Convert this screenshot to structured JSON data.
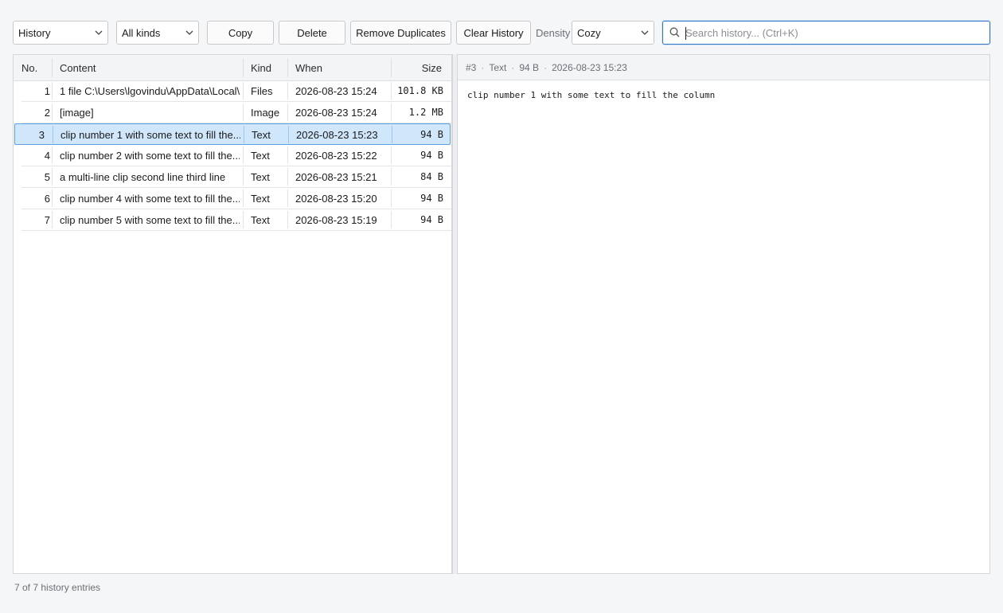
{
  "toolbar": {
    "view_select": "History",
    "kind_select": "All kinds",
    "copy_label": "Copy",
    "delete_label": "Delete",
    "remove_duplicates_label": "Remove Duplicates",
    "clear_history_label": "Clear History",
    "density_label": "Density",
    "density_select": "Cozy",
    "search_placeholder": "Search history...  (Ctrl+K)"
  },
  "list": {
    "columns": {
      "no": "No.",
      "content": "Content",
      "kind": "Kind",
      "when": "When",
      "size": "Size"
    },
    "rows": [
      {
        "no": "1",
        "content": "1 file C:\\Users\\lgovindu\\AppData\\Local\\...",
        "kind": "Files",
        "when": "2026-08-23 15:24",
        "size": "101.8 KB"
      },
      {
        "no": "2",
        "content": "[image]",
        "kind": "Image",
        "when": "2026-08-23 15:24",
        "size": "1.2 MB"
      },
      {
        "no": "3",
        "content": "clip number 1 with some text to fill the...",
        "kind": "Text",
        "when": "2026-08-23 15:23",
        "size": "94 B"
      },
      {
        "no": "4",
        "content": "clip number 2 with some text to fill the...",
        "kind": "Text",
        "when": "2026-08-23 15:22",
        "size": "94 B"
      },
      {
        "no": "5",
        "content": "a multi-line clip second line third line",
        "kind": "Text",
        "when": "2026-08-23 15:21",
        "size": "84 B"
      },
      {
        "no": "6",
        "content": "clip number 4 with some text to fill the...",
        "kind": "Text",
        "when": "2026-08-23 15:20",
        "size": "94 B"
      },
      {
        "no": "7",
        "content": "clip number 5 with some text to fill the...",
        "kind": "Text",
        "when": "2026-08-23 15:19",
        "size": "94 B"
      }
    ],
    "selected_row": "3"
  },
  "preview": {
    "id": "#3",
    "kind": "Text",
    "size": "94 B",
    "when": "2026-08-23 15:23",
    "body": "clip number 1 with some text to fill the column"
  },
  "status": "7 of 7 history entries"
}
